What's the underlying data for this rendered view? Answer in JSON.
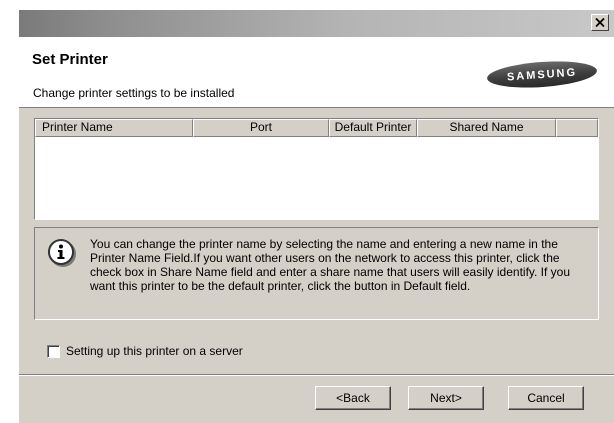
{
  "window": {
    "close_icon": "close-icon"
  },
  "header": {
    "title": "Set Printer",
    "subtitle": "Change printer settings to be installed",
    "logo_text": "SAMSUNG"
  },
  "printer_list": {
    "columns": [
      "Printer Name",
      "Port",
      "Default Printer",
      "Shared Name"
    ],
    "rows": []
  },
  "info": {
    "icon": "info-icon",
    "text": "You can change the printer name by selecting the name and entering a new name in the Printer Name Field.If you want other users on the network to access this printer, click the check box in Share Name field and enter a share name that users will easily identify. If you want this printer to be the default printer, click the button in Default field."
  },
  "server_option": {
    "label": "Setting up this printer on a server",
    "checked": false
  },
  "buttons": {
    "back": "<Back",
    "next": "Next>",
    "cancel": "Cancel"
  }
}
